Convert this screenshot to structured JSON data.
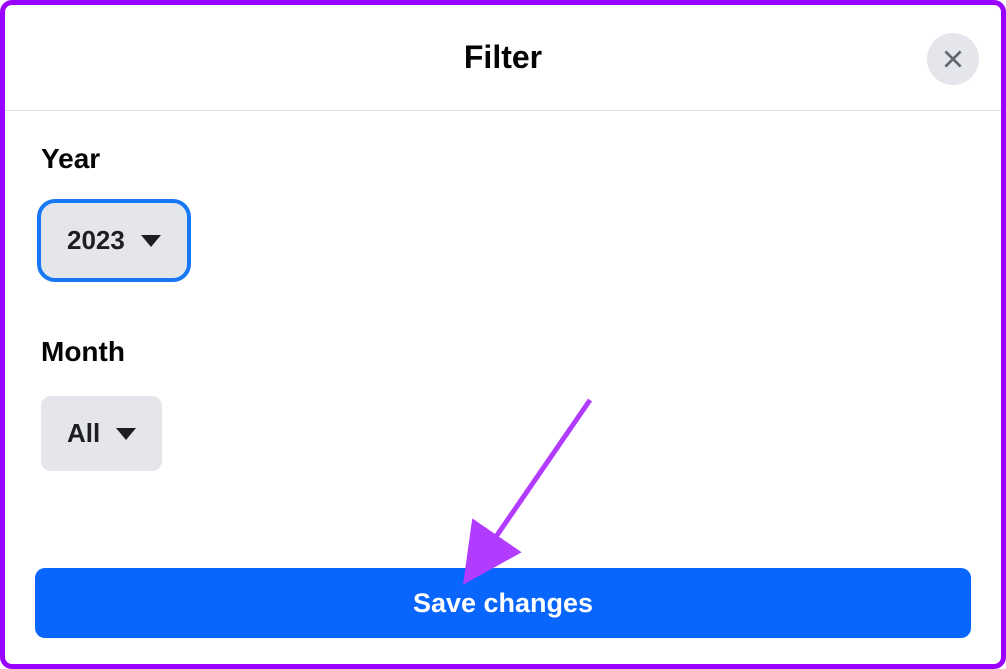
{
  "header": {
    "title": "Filter"
  },
  "fields": {
    "year": {
      "label": "Year",
      "value": "2023"
    },
    "month": {
      "label": "Month",
      "value": "All"
    }
  },
  "actions": {
    "save_label": "Save changes"
  },
  "annotation": {
    "arrow_color": "#b13cff"
  }
}
